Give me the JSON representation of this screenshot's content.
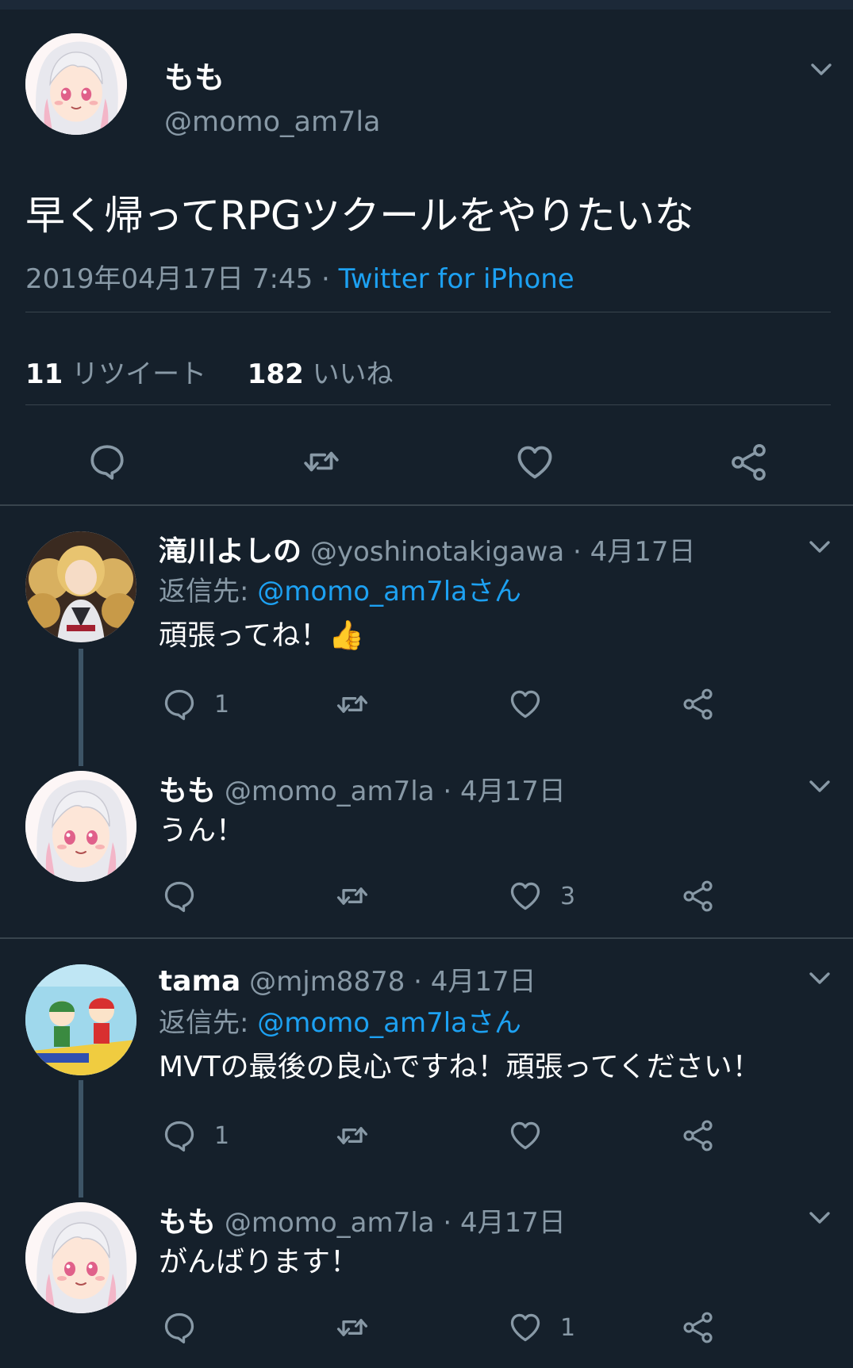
{
  "colors": {
    "background": "#15202b",
    "accent": "#1da1f2",
    "muted": "#8899a6",
    "divider": "#38444d"
  },
  "main_tweet": {
    "name": "もも",
    "handle": "@momo_am7la",
    "text": "早く帰ってRPGツクールをやりたいな",
    "timestamp": "2019年04月17日 7:45 · ",
    "source": "Twitter for iPhone",
    "retweets_count": "11",
    "retweets_label": "リツイート",
    "likes_count": "182",
    "likes_label": "いいね"
  },
  "replies": [
    {
      "name": "滝川よしの",
      "handle": "@yoshinotakigawa",
      "date": " · 4月17日",
      "reply_to_label": "返信先: ",
      "reply_to": "@momo_am7laさん",
      "text": "頑張ってね！👍",
      "reply_count": "1",
      "like_count": ""
    },
    {
      "name": "もも",
      "handle": "@momo_am7la",
      "date": " · 4月17日",
      "text": "うん！",
      "reply_count": "",
      "like_count": "3"
    },
    {
      "name": "tama",
      "handle": "@mjm8878",
      "date": " · 4月17日",
      "reply_to_label": "返信先: ",
      "reply_to": "@momo_am7laさん",
      "text": "MVTの最後の良心ですね！頑張ってください！",
      "reply_count": "1",
      "like_count": ""
    },
    {
      "name": "もも",
      "handle": "@momo_am7la",
      "date": " · 4月17日",
      "text": "がんばります！",
      "reply_count": "",
      "like_count": "1"
    }
  ],
  "icons": {
    "reply": "speech-bubble-icon",
    "retweet": "retweet-icon",
    "like": "heart-icon",
    "share": "share-icon",
    "menu": "chevron-down-icon"
  }
}
